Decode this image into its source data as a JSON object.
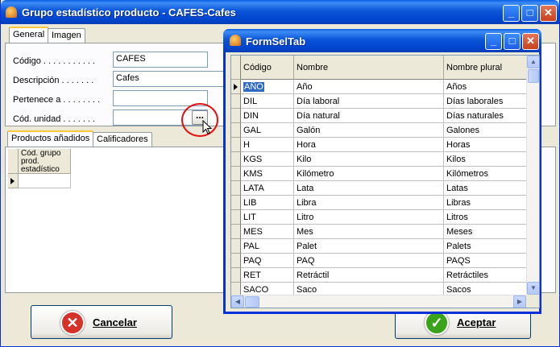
{
  "main_window": {
    "title": "Grupo estadístico producto - CAFES-Cafes",
    "caption_buttons": {
      "minimize": "_",
      "maximize": "□",
      "close": "✕"
    },
    "tabs": [
      {
        "label": "General",
        "active": true
      },
      {
        "label": "Imagen",
        "active": false
      }
    ],
    "fields": {
      "codigo": {
        "label": "Código . . . . . . . . . . .",
        "value": "CAFES"
      },
      "descripcion": {
        "label": "Descripción . . . . . . .",
        "value": "Cafes"
      },
      "pertenece": {
        "label": "Pertenece a . . . . . . . .",
        "value": ""
      },
      "cod_unidad": {
        "label": "Cód. unidad . . . . . . .",
        "value": ""
      }
    },
    "ellipsis_button": "...",
    "sub_tabs": [
      {
        "label": "Productos añadidos",
        "active": true
      },
      {
        "label": "Calificadores",
        "active": false
      }
    ],
    "products_grid_header": "Cód. grupo prod. estadístico",
    "buttons": {
      "cancel": "Cancelar",
      "accept": "Aceptar"
    },
    "colors": {
      "cancel_icon": "#d6322a",
      "accept_icon": "#3aa31c",
      "annotation_circle": "#e21010"
    }
  },
  "popup": {
    "title": "FormSelTab",
    "columns": [
      "Código",
      "Nombre",
      "Nombre plural"
    ],
    "selected_index": 0,
    "rows": [
      {
        "codigo": "AÑO",
        "nombre": "Año",
        "plural": "Años"
      },
      {
        "codigo": "DIL",
        "nombre": "Día laboral",
        "plural": "Días laborales"
      },
      {
        "codigo": "DIN",
        "nombre": "Día natural",
        "plural": "Días naturales"
      },
      {
        "codigo": "GAL",
        "nombre": "Galón",
        "plural": "Galones"
      },
      {
        "codigo": "H",
        "nombre": "Hora",
        "plural": "Horas"
      },
      {
        "codigo": "KGS",
        "nombre": "Kilo",
        "plural": "Kilos"
      },
      {
        "codigo": "KMS",
        "nombre": "Kilómetro",
        "plural": "Kilómetros"
      },
      {
        "codigo": "LATA",
        "nombre": "Lata",
        "plural": "Latas"
      },
      {
        "codigo": "LIB",
        "nombre": "Libra",
        "plural": "Libras"
      },
      {
        "codigo": "LIT",
        "nombre": "Litro",
        "plural": "Litros"
      },
      {
        "codigo": "MES",
        "nombre": "Mes",
        "plural": "Meses"
      },
      {
        "codigo": "PAL",
        "nombre": "Palet",
        "plural": "Palets"
      },
      {
        "codigo": "PAQ",
        "nombre": "PAQ",
        "plural": "PAQS"
      },
      {
        "codigo": "RET",
        "nombre": "Retráctil",
        "plural": "Retráctiles"
      },
      {
        "codigo": "SACO",
        "nombre": "Saco",
        "plural": "Sacos"
      }
    ]
  }
}
